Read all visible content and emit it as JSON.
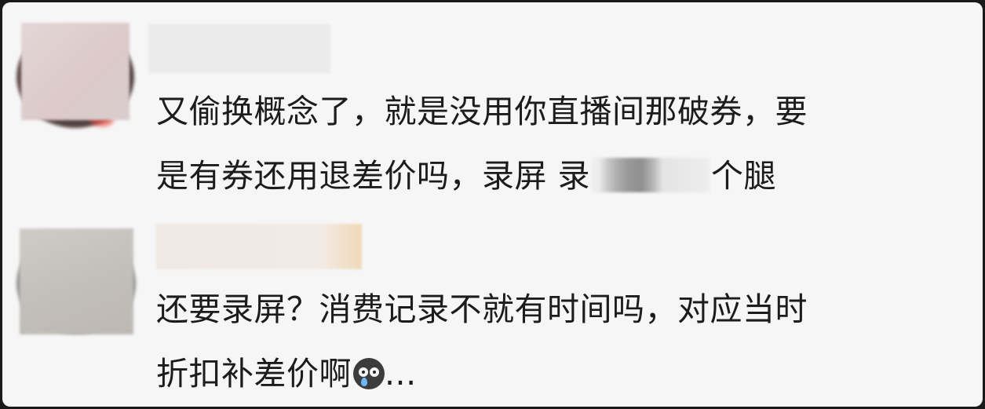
{
  "comments": [
    {
      "text_line_1": "又偷换概念了，就是没用你直播间那破券，要",
      "text_line_2_before": "是有券还用退差价吗，录屏 录",
      "text_line_2_after": "个腿"
    },
    {
      "text_line_1": "还要录屏？消费记录不就有时间吗，对应当时",
      "text_line_2_before": "折扣补差价啊",
      "text_line_2_after": "...",
      "emoji": "crying-face-icon"
    }
  ]
}
